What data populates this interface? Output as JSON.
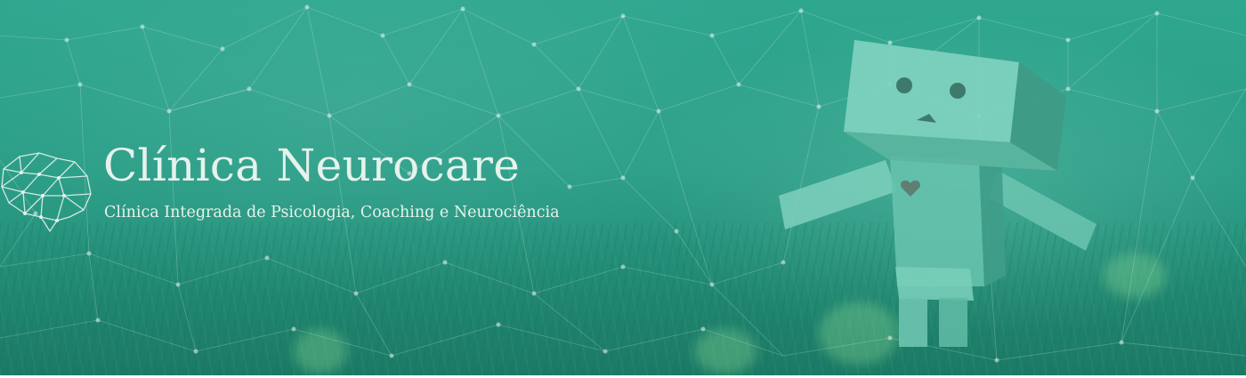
{
  "header": {
    "title": "Clínica Neurocare",
    "subtitle": "Clínica Integrada de Psicologia, Coaching e Neurociência"
  },
  "icons": {
    "logo": "brain-network-icon",
    "illustration": "cardboard-robot-image"
  },
  "colors": {
    "background": "#2a9d86",
    "text": "#e6f2ec",
    "network_lines": "#d8efe6"
  }
}
